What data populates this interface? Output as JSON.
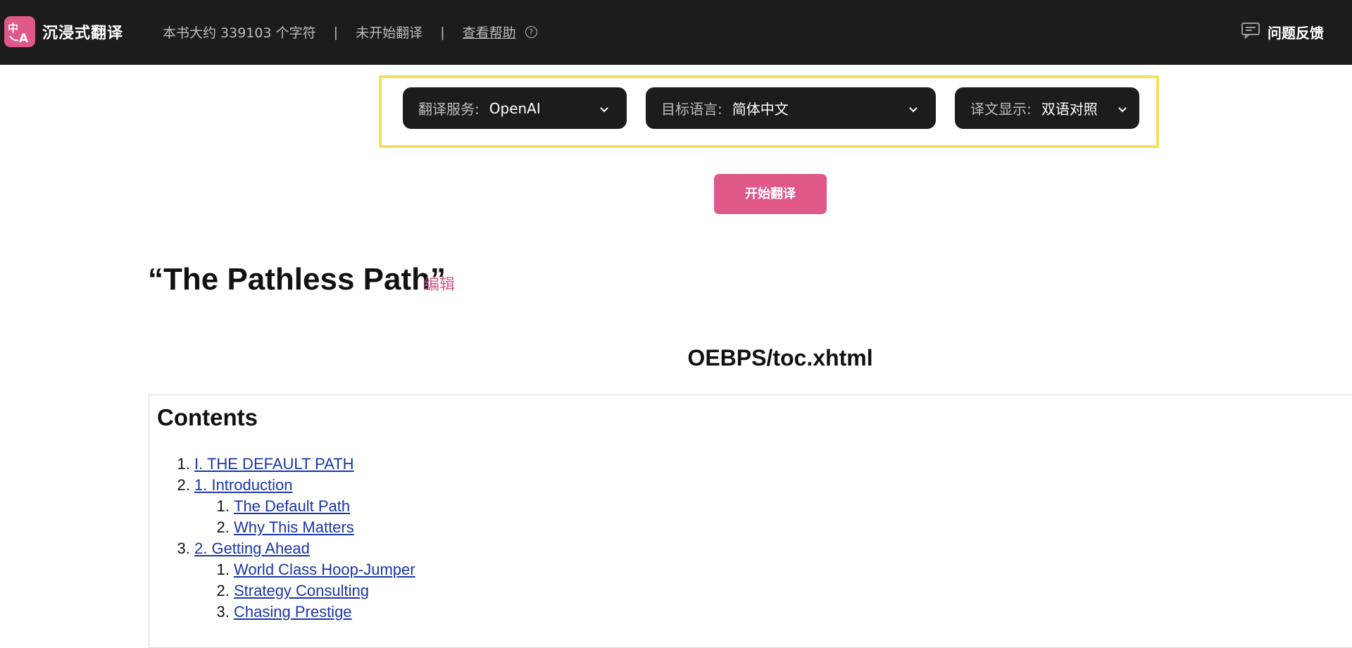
{
  "header": {
    "app_name": "沉浸式翻译",
    "char_count": "本书大约 339103 个字符",
    "separator": "|",
    "status": "未开始翻译",
    "help_link": "查看帮助",
    "help_icon": "?",
    "feedback": "问题反馈",
    "logo_icon": "translate-logo-icon"
  },
  "options": {
    "service": {
      "label": "翻译服务:",
      "value": "OpenAI"
    },
    "target_language": {
      "label": "目标语言:",
      "value": "简体中文"
    },
    "display": {
      "label": "译文显示:",
      "value": "双语对照"
    }
  },
  "start_button": "开始翻译",
  "book": {
    "title": "“The Pathless Path”",
    "edit": "编辑"
  },
  "content": {
    "file_title": "OEBPS/toc.xhtml",
    "heading": "Contents",
    "toc": [
      {
        "label": "I. THE DEFAULT PATH",
        "children": []
      },
      {
        "label": "1. Introduction",
        "children": [
          "The Default Path",
          "Why This Matters"
        ]
      },
      {
        "label": "2. Getting Ahead",
        "children": [
          "World Class Hoop-Jumper",
          "Strategy Consulting",
          "Chasing Prestige"
        ]
      }
    ]
  },
  "colors": {
    "topbar": "#1c1c1c",
    "accent": "#e0578a",
    "highlight_frame": "#f4e05c",
    "link": "#1a35a8"
  }
}
